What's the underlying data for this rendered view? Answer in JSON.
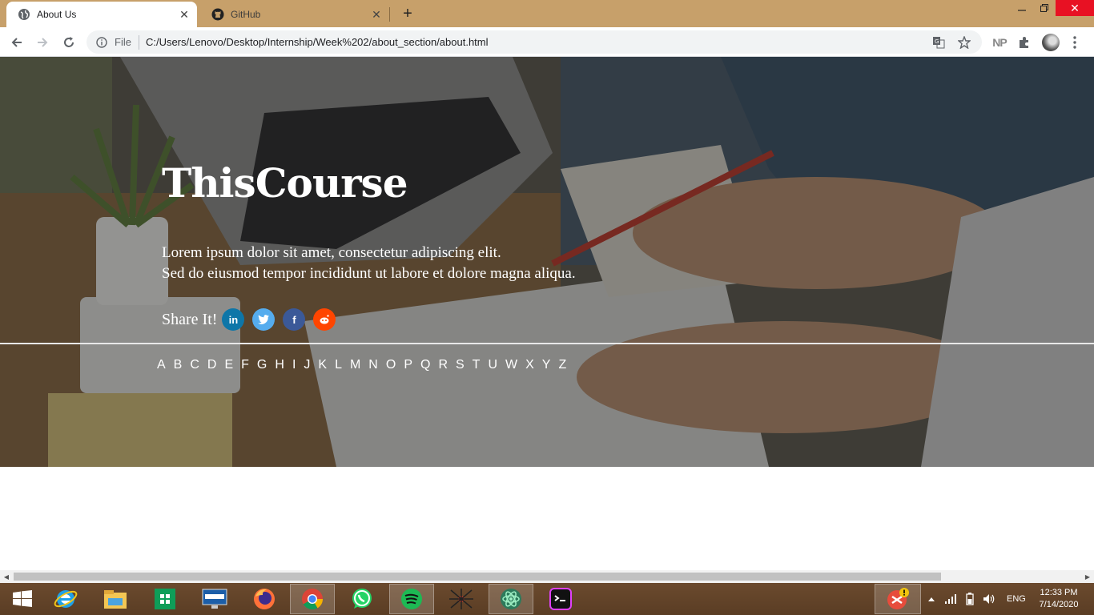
{
  "browser": {
    "tabs": [
      {
        "title": "About Us",
        "active": true,
        "icon": "globe-icon"
      },
      {
        "title": "GitHub",
        "active": false,
        "icon": "github-icon"
      }
    ],
    "omnibox": {
      "scheme_label": "File",
      "url": "C:/Users/Lenovo/Desktop/Internship/Week%202/about_section/about.html"
    },
    "extension_label": "NP",
    "accent": "#c7a06a"
  },
  "page": {
    "brand": "ThisCourse",
    "tagline_line1": "Lorem ipsum dolor sit amet, consectetur adipiscing elit.",
    "tagline_line2": "Sed do eiusmod tempor incididunt ut labore et dolore magna aliqua.",
    "share_label": "Share It!",
    "social": [
      {
        "name": "linkedin",
        "glyph": "in",
        "color": "#0e76a8"
      },
      {
        "name": "twitter",
        "glyph": "t",
        "color": "#55acee"
      },
      {
        "name": "facebook",
        "glyph": "f",
        "color": "#3b5998"
      },
      {
        "name": "reddit",
        "glyph": "r",
        "color": "#ff4500"
      }
    ],
    "alphabet": [
      "A",
      "B",
      "C",
      "D",
      "E",
      "F",
      "G",
      "H",
      "I",
      "J",
      "K",
      "L",
      "M",
      "N",
      "O",
      "P",
      "Q",
      "R",
      "S",
      "T",
      "U",
      "W",
      "X",
      "Y",
      "Z"
    ]
  },
  "taskbar": {
    "apps": [
      "start",
      "internet-explorer",
      "file-explorer",
      "store",
      "lenovo",
      "firefox",
      "chrome",
      "whatsapp",
      "spotify",
      "spider",
      "atom",
      "terminal"
    ],
    "language": "ENG",
    "time": "12:33 PM",
    "date": "7/14/2020"
  }
}
